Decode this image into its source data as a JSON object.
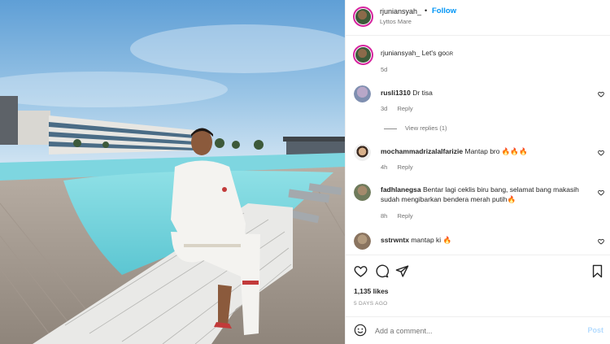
{
  "header": {
    "username": "rjuniansyah_",
    "separator": "•",
    "follow_label": "Follow",
    "location": "Lyttos Mare"
  },
  "caption": {
    "username": "rjuniansyah_",
    "text": "Let's go",
    "suffix": "GR",
    "time": "5d"
  },
  "comments": [
    {
      "username": "rusli1310",
      "text": "Dr tisa",
      "time": "3d",
      "reply_label": "Reply",
      "view_replies": "View replies (1)"
    },
    {
      "username": "mochammadrizalalfarizie",
      "text": "Mantap bro 🔥🔥🔥",
      "time": "4h",
      "reply_label": "Reply"
    },
    {
      "username": "fadhlanegsa",
      "text": "Bentar lagi ceklis biru bang, selamat bang makasih sudah mengibarkan bendera merah putih🔥",
      "time": "8h",
      "reply_label": "Reply"
    },
    {
      "username": "sstrwntx",
      "text": "mantap ki 🔥",
      "time": "",
      "reply_label": ""
    }
  ],
  "icons": {
    "like": "heart-icon",
    "comment": "comment-icon",
    "share": "share-icon",
    "save": "bookmark-icon",
    "emoji": "smile-icon"
  },
  "stats": {
    "likes": "1,135 likes",
    "date": "5 DAYS AGO"
  },
  "add_comment": {
    "placeholder": "Add a comment...",
    "post_label": "Post"
  },
  "colors": {
    "accent": "#0095f6",
    "post_disabled": "#b3dbff",
    "muted": "#737373"
  }
}
